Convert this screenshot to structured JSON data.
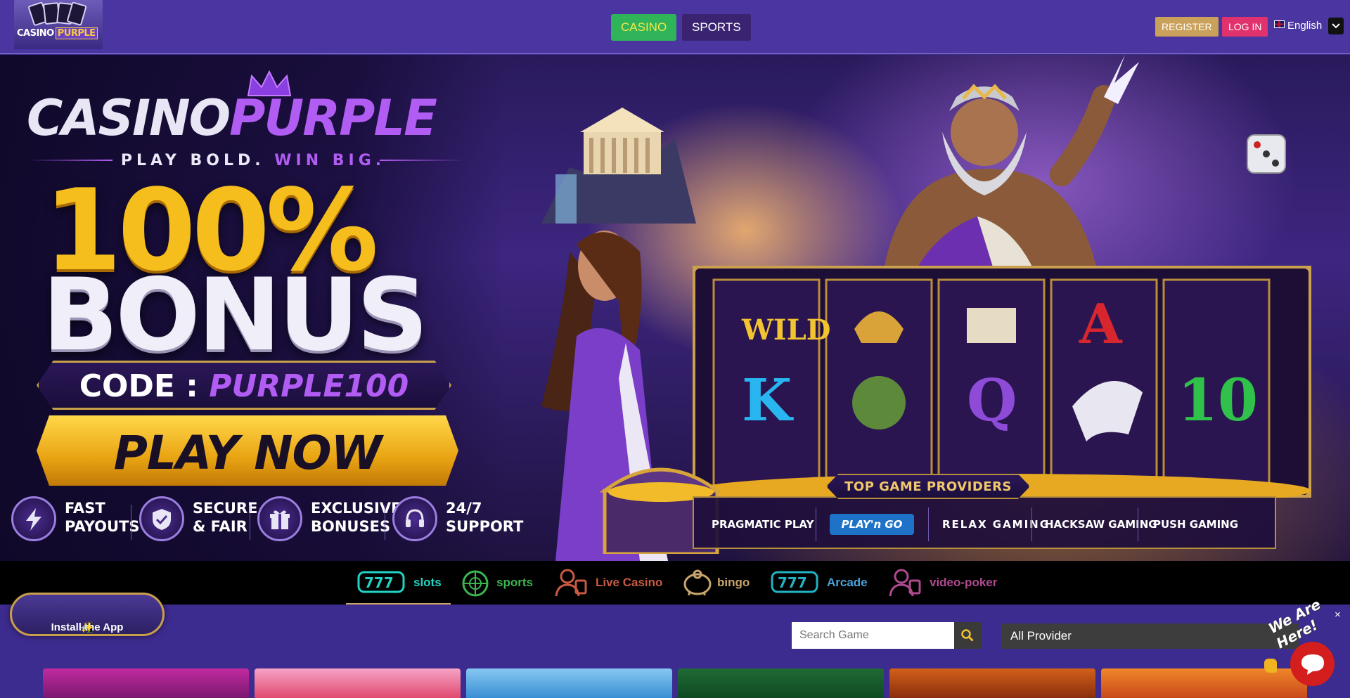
{
  "header": {
    "logo_text": "CASINO",
    "logo_text_accent": "PURPLE",
    "nav": {
      "casino": "CASINO",
      "sports": "SPORTS"
    },
    "register": "REGISTER",
    "login": "LOG IN",
    "language": "English",
    "icons": {
      "flag": "uk-flag-icon",
      "toggle": "chevron-down-icon"
    }
  },
  "banner": {
    "brand_white": "CASINO",
    "brand_purple": "PURPLE",
    "tagline_a": "PLAY BOLD.",
    "tagline_b": "WIN BIG.",
    "bonus_percent": "100%",
    "bonus_word": "BONUS",
    "code_label": "CODE :",
    "code_value": "PURPLE100",
    "cta": "PLAY NOW",
    "features": [
      {
        "icon": "lightning-icon",
        "label": "FAST\nPAYOUTS"
      },
      {
        "icon": "shield-check-icon",
        "label": "SECURE\n& FAIR"
      },
      {
        "icon": "gift-icon",
        "label": "EXCLUSIVE\nBONUSES"
      },
      {
        "icon": "headset-icon",
        "label": "24/7\nSUPPORT"
      }
    ],
    "providers_title": "TOP GAME PROVIDERS",
    "providers": [
      "PRAGMATIC PLAY",
      "PLAY'n GO",
      "RELAX GAMING",
      "HACKSAW GAMING",
      "PUSH GAMING"
    ],
    "reel_symbols": [
      "WILD",
      "K",
      "Q",
      "A",
      "10"
    ]
  },
  "categories": [
    {
      "label": "slots",
      "icon": "slot-machine-icon",
      "color": "#22d3c5",
      "active": true
    },
    {
      "label": "sports",
      "icon": "sports-ball-icon",
      "color": "#3bb64f",
      "active": false
    },
    {
      "label": "Live Casino",
      "icon": "live-dealer-icon",
      "color": "#c95a43",
      "active": false
    },
    {
      "label": "bingo",
      "icon": "bingo-pig-icon",
      "color": "#c9a66b",
      "active": false
    },
    {
      "label": "Arcade",
      "icon": "arcade-777-icon",
      "color": "#4aa3d8",
      "active": false
    },
    {
      "label": "video-poker",
      "icon": "poker-dealer-icon",
      "color": "#b04a8f",
      "active": false
    }
  ],
  "install_app": "Install the App",
  "search": {
    "placeholder": "Search Game"
  },
  "provider_filter": {
    "selected": "All Provider"
  },
  "chat": {
    "badge_text": "We Are Here!",
    "close": "×"
  },
  "colors": {
    "topbar": "#4a35a1",
    "page_bg": "#3d2c8f",
    "casino_btn": "#2fb45a",
    "register_btn": "#c9a15a",
    "login_btn": "#e0336d",
    "chat": "#d41e1e"
  }
}
